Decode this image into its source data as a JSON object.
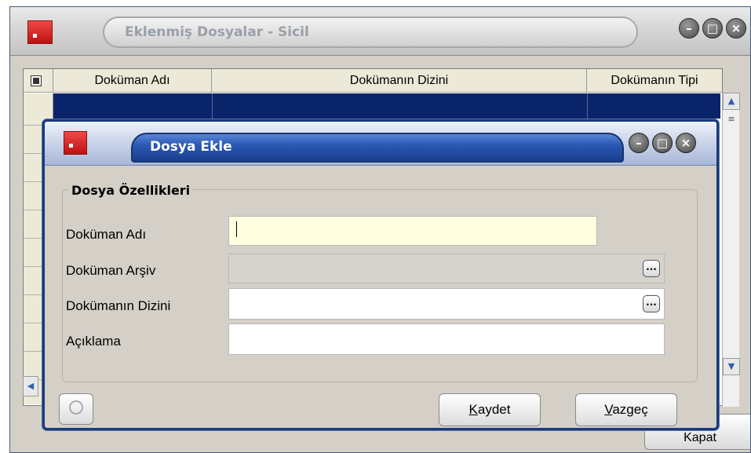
{
  "background_window": {
    "title": "Eklenmiş Dosyalar - Sicil",
    "controls": {
      "minimize": "–",
      "maximize": "□",
      "close": "×"
    },
    "grid": {
      "columns": [
        "Doküman Adı",
        "Dokümanın Dizini",
        "Dokümanın Tipi"
      ],
      "scroll_up": "▲",
      "scroll_down": "▼",
      "scroll_thumb": "≡",
      "scroll_left": "◀"
    },
    "bottom_button": "Kapat"
  },
  "dialog": {
    "title": "Dosya Ekle",
    "controls": {
      "minimize": "–",
      "maximize": "□",
      "close": "×"
    },
    "group_title": "Dosya Özellikleri",
    "fields": [
      {
        "label": "Doküman Adı",
        "value": ""
      },
      {
        "label": "Doküman Arşiv",
        "value": "",
        "button": "..."
      },
      {
        "label": "Dokümanın Dizini",
        "value": "",
        "button": "..."
      },
      {
        "label": "Açıklama",
        "value": ""
      }
    ],
    "buttons": {
      "save": {
        "mnemonic": "K",
        "rest": "aydet"
      },
      "cancel": {
        "mnemonic": "V",
        "rest": "azgeç"
      }
    }
  }
}
